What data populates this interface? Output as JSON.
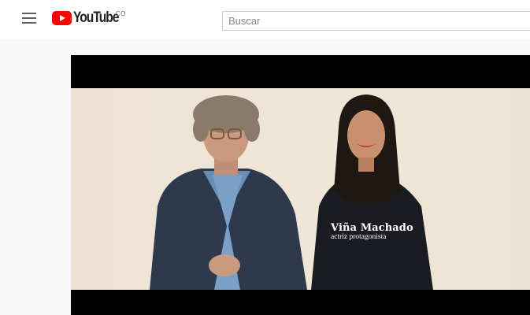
{
  "header": {
    "logo_text": "YouTube",
    "country_code": "CO",
    "search_placeholder": "Buscar"
  },
  "video": {
    "overlay_name": "Viña Machado",
    "overlay_role": "actriz protagonista"
  },
  "colors": {
    "brand_red": "#ff0000",
    "letterbox": "#000000",
    "background": "#f9f9f9"
  }
}
